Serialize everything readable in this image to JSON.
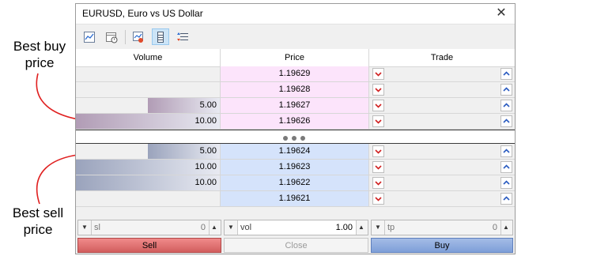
{
  "annotations": {
    "best_buy": [
      "Best buy",
      "price"
    ],
    "best_sell": [
      "Best sell",
      "price"
    ]
  },
  "window": {
    "title": "EURUSD, Euro vs US Dollar",
    "close_glyph": "✕"
  },
  "toolbar": {
    "buttons": [
      "chart-icon",
      "calendar-icon",
      "trade-icon",
      "depth-icon",
      "list-icon"
    ],
    "active": "depth-icon"
  },
  "headers": {
    "volume": "Volume",
    "price": "Price",
    "trade": "Trade"
  },
  "ask_rows": [
    {
      "volume": "",
      "volume_fraction": 0,
      "price": "1.19629"
    },
    {
      "volume": "",
      "volume_fraction": 0,
      "price": "1.19628"
    },
    {
      "volume": "5.00",
      "volume_fraction": 0.5,
      "price": "1.19627"
    },
    {
      "volume": "10.00",
      "volume_fraction": 1.0,
      "price": "1.19626"
    }
  ],
  "bid_rows": [
    {
      "volume": "5.00",
      "volume_fraction": 0.5,
      "price": "1.19624"
    },
    {
      "volume": "10.00",
      "volume_fraction": 1.0,
      "price": "1.19623"
    },
    {
      "volume": "10.00",
      "volume_fraction": 1.0,
      "price": "1.19622"
    },
    {
      "volume": "",
      "volume_fraction": 0,
      "price": "1.19621"
    }
  ],
  "controls": {
    "sl": {
      "label": "sl",
      "value": "0"
    },
    "vol": {
      "label": "vol",
      "value": "1.00"
    },
    "tp": {
      "label": "tp",
      "value": "0"
    }
  },
  "actions": {
    "sell": "Sell",
    "close": "Close",
    "buy": "Buy"
  },
  "colors": {
    "ask_price_bg": "#fce4fb",
    "bid_price_bg": "#d5e3fb",
    "ask_volume_bar": "#b19cb5",
    "bid_volume_bar": "#9aa3bc",
    "arrow_red": "#e02020"
  }
}
